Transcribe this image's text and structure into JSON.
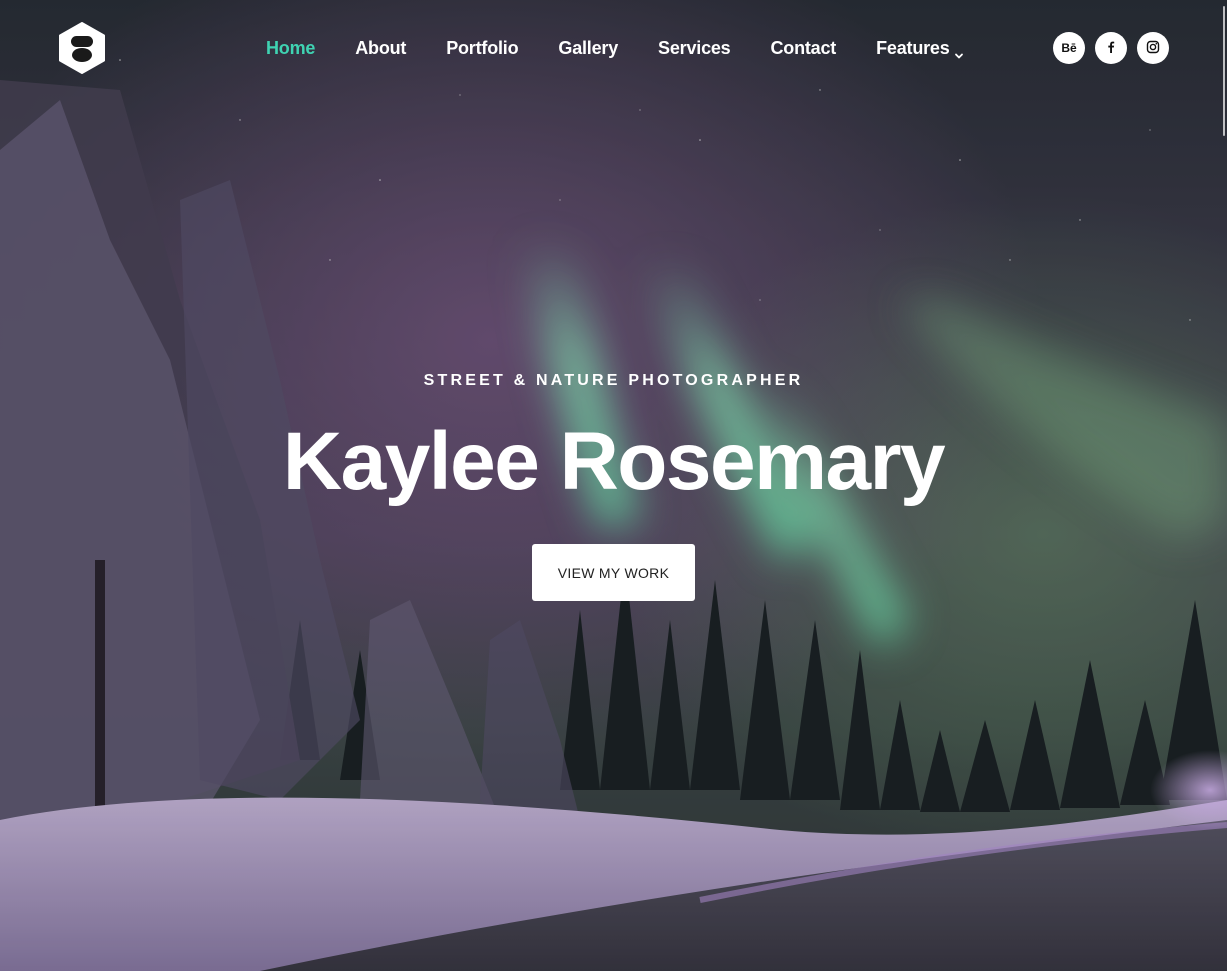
{
  "brand": {
    "logo_icon": "hexagon-logo-icon"
  },
  "nav": {
    "items": [
      {
        "label": "Home",
        "active": true
      },
      {
        "label": "About",
        "active": false
      },
      {
        "label": "Portfolio",
        "active": false
      },
      {
        "label": "Gallery",
        "active": false
      },
      {
        "label": "Services",
        "active": false
      },
      {
        "label": "Contact",
        "active": false
      },
      {
        "label": "Features",
        "active": false,
        "dropdown": true
      }
    ]
  },
  "socials": {
    "behance_label": "Bē",
    "facebook_icon": "facebook-icon",
    "instagram_icon": "instagram-icon"
  },
  "hero": {
    "subtitle": "STREET & NATURE PHOTOGRAPHER",
    "title": "Kaylee Rosemary",
    "cta_label": "VIEW MY WORK"
  },
  "colors": {
    "accent": "#3fd3b2",
    "text": "#ffffff",
    "button_bg": "#ffffff",
    "button_text": "#222222"
  }
}
